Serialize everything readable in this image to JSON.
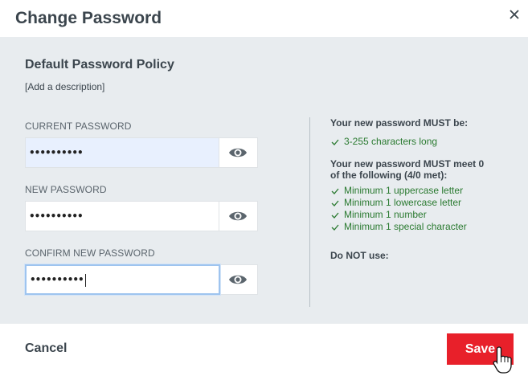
{
  "dialog": {
    "title": "Change Password",
    "close_icon": "close-icon"
  },
  "policy": {
    "title": "Default Password Policy",
    "description": "[Add a description]"
  },
  "fields": [
    {
      "label": "CURRENT PASSWORD",
      "value": "••••••••••"
    },
    {
      "label": "NEW PASSWORD",
      "value": "••••••••••"
    },
    {
      "label": "CONFIRM NEW PASSWORD",
      "value": "••••••••••"
    }
  ],
  "rules": {
    "must_be_heading": "Your new password MUST be:",
    "must_be": [
      "3-255 characters long"
    ],
    "must_meet_heading_1": "Your new password MUST meet 0",
    "must_meet_heading_2": "of the following (4/0 met):",
    "must_meet": [
      "Minimum 1 uppercase letter",
      "Minimum 1 lowercase letter",
      "Minimum 1 number",
      "Minimum 1 special character"
    ],
    "do_not_heading": "Do NOT use:"
  },
  "footer": {
    "cancel_label": "Cancel",
    "save_label": "Save"
  },
  "colors": {
    "accent": "#e8202a",
    "success": "#2a7a30",
    "panel": "#e8ecef"
  }
}
